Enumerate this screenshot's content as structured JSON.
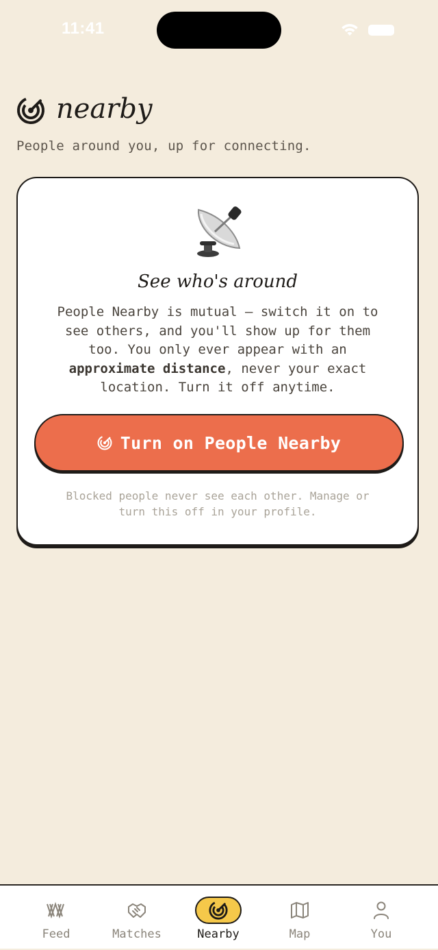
{
  "status_bar": {
    "time": "11:41"
  },
  "header": {
    "title": "nearby",
    "subtitle": "People around you, up for connecting.",
    "logo_icon": "radar-icon"
  },
  "card": {
    "illustration": "satellite-dish-icon",
    "heading": "See who's around",
    "body_part1": "People Nearby is mutual — switch it on to see others, and you'll show up for them too. You only ever appear with an ",
    "body_bold": "approximate distance",
    "body_part2": ", never your exact location. Turn it off anytime.",
    "button_label": "Turn on People Nearby",
    "footnote": "Blocked people never see each other. Manage or turn this off in your profile."
  },
  "tabs": [
    {
      "label": "Feed",
      "icon": "feed-icon",
      "active": false
    },
    {
      "label": "Matches",
      "icon": "handshake-icon",
      "active": false
    },
    {
      "label": "Nearby",
      "icon": "radar-icon",
      "active": true
    },
    {
      "label": "Map",
      "icon": "map-icon",
      "active": false
    },
    {
      "label": "You",
      "icon": "user-icon",
      "active": false
    }
  ],
  "colors": {
    "background": "#f4ecdd",
    "accent": "#ec6e4c",
    "active_tab": "#f5c84a",
    "ink": "#1e1b18"
  }
}
